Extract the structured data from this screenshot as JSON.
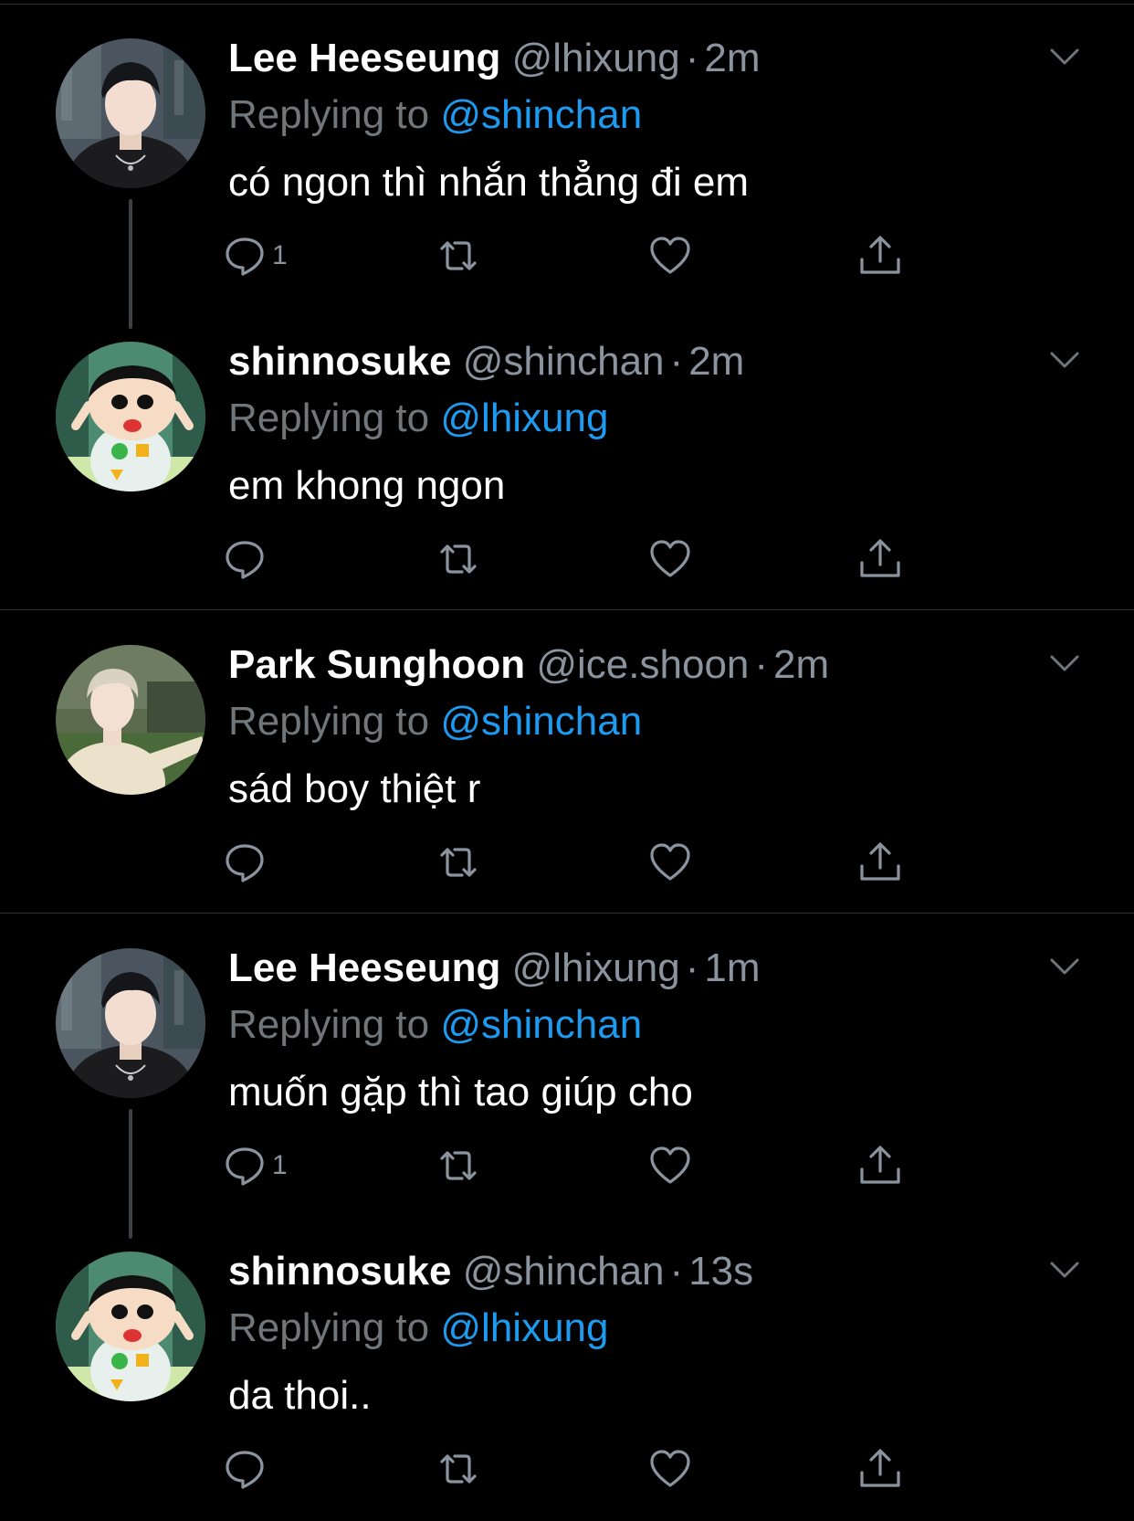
{
  "colors": {
    "background": "#000000",
    "name": "#ffffff",
    "meta": "#8b949e",
    "mention": "#1d9bf0",
    "divider": "#2f3336"
  },
  "icons": {
    "reply": "comment-bubble-icon",
    "retweet": "retweet-icon",
    "like": "heart-icon",
    "share": "share-icon",
    "more": "chevron-down-icon"
  },
  "tweets": [
    {
      "name": "Lee Heeseung",
      "handle": "@lhixung",
      "dot": "·",
      "time": "2m",
      "replying_prefix": "Replying to",
      "replying_to": "@shinchan",
      "text": "có ngon thì nhắn thẳng đi em",
      "reply_count": "1"
    },
    {
      "name": "shinnosuke",
      "handle": "@shinchan",
      "dot": "·",
      "time": "2m",
      "replying_prefix": "Replying to",
      "replying_to": "@lhixung",
      "text": "em khong ngon",
      "reply_count": ""
    },
    {
      "name": "Park Sunghoon",
      "handle": "@ice.shoon",
      "dot": "·",
      "time": "2m",
      "replying_prefix": "Replying to",
      "replying_to": "@shinchan",
      "text": "sád boy thiệt r",
      "reply_count": ""
    },
    {
      "name": "Lee Heeseung",
      "handle": "@lhixung",
      "dot": "·",
      "time": "1m",
      "replying_prefix": "Replying to",
      "replying_to": "@shinchan",
      "text": "muốn gặp thì tao giúp cho",
      "reply_count": "1"
    },
    {
      "name": "shinnosuke",
      "handle": "@shinchan",
      "dot": "·",
      "time": "13s",
      "replying_prefix": "Replying to",
      "replying_to": "@lhixung",
      "text": "da thoi..",
      "reply_count": ""
    }
  ]
}
